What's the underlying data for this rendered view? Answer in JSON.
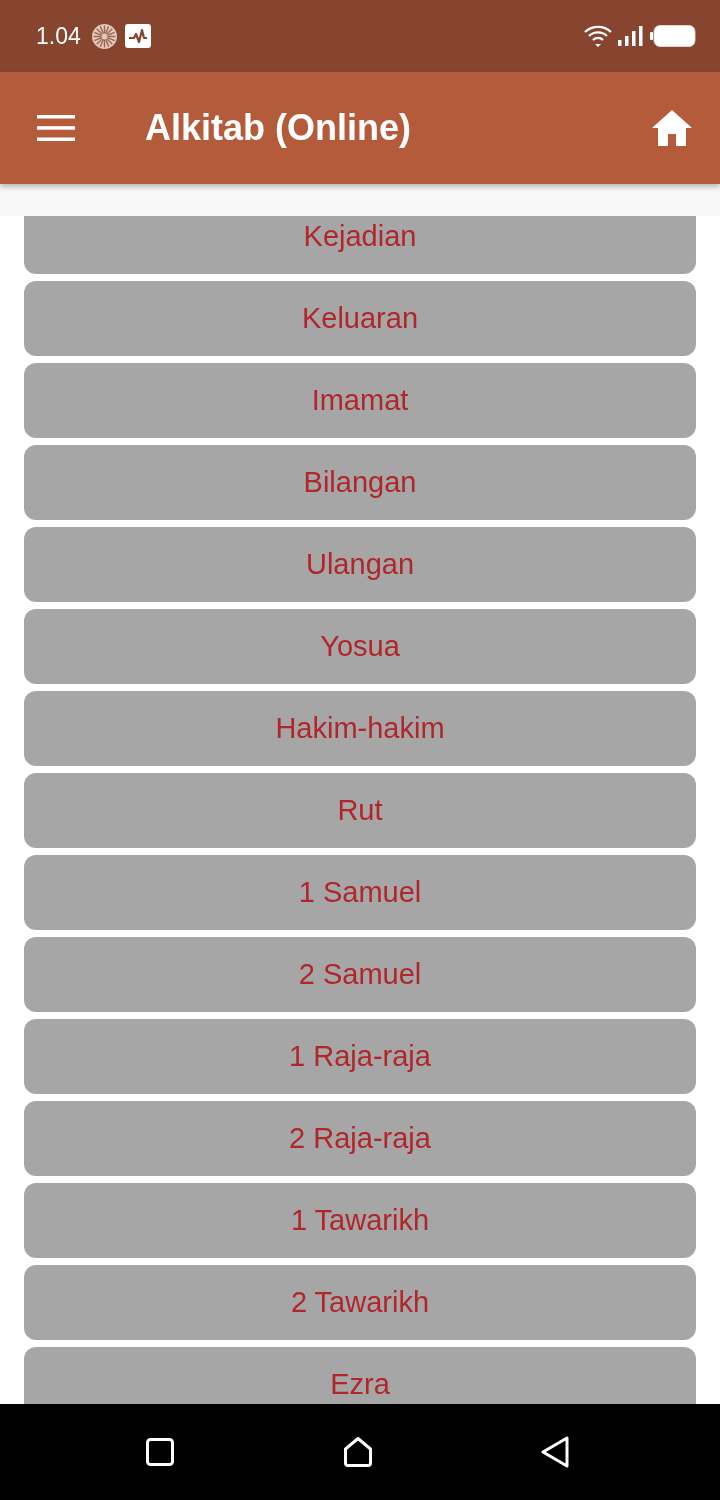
{
  "status_bar": {
    "time": "1.04"
  },
  "app_bar": {
    "title": "Alkitab (Online)"
  },
  "books": [
    "Kejadian",
    "Keluaran",
    "Imamat",
    "Bilangan",
    "Ulangan",
    "Yosua",
    "Hakim-hakim",
    "Rut",
    "1 Samuel",
    "2 Samuel",
    "1 Raja-raja",
    "2 Raja-raja",
    "1 Tawarikh",
    "2 Tawarikh",
    "Ezra"
  ]
}
